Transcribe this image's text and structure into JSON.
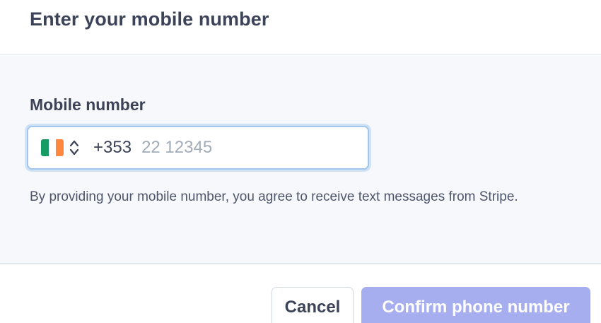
{
  "header": {
    "title": "Enter your mobile number"
  },
  "form": {
    "label": "Mobile number",
    "country": {
      "flag_colors": [
        "#169b62",
        "#ffffff",
        "#ff883e"
      ],
      "chevron_icon": "up-down-chevron-icon"
    },
    "dial_code": "+353",
    "number_value": "",
    "number_placeholder": "22 12345",
    "consent_text": "By providing your mobile number, you agree to receive text messages from Stripe."
  },
  "footer": {
    "cancel_label": "Cancel",
    "confirm_label": "Confirm phone number"
  },
  "colors": {
    "focus_ring": "#a3c6ec",
    "confirm_disabled": "#a6aef0",
    "panel_bg": "#f6f8fb"
  }
}
